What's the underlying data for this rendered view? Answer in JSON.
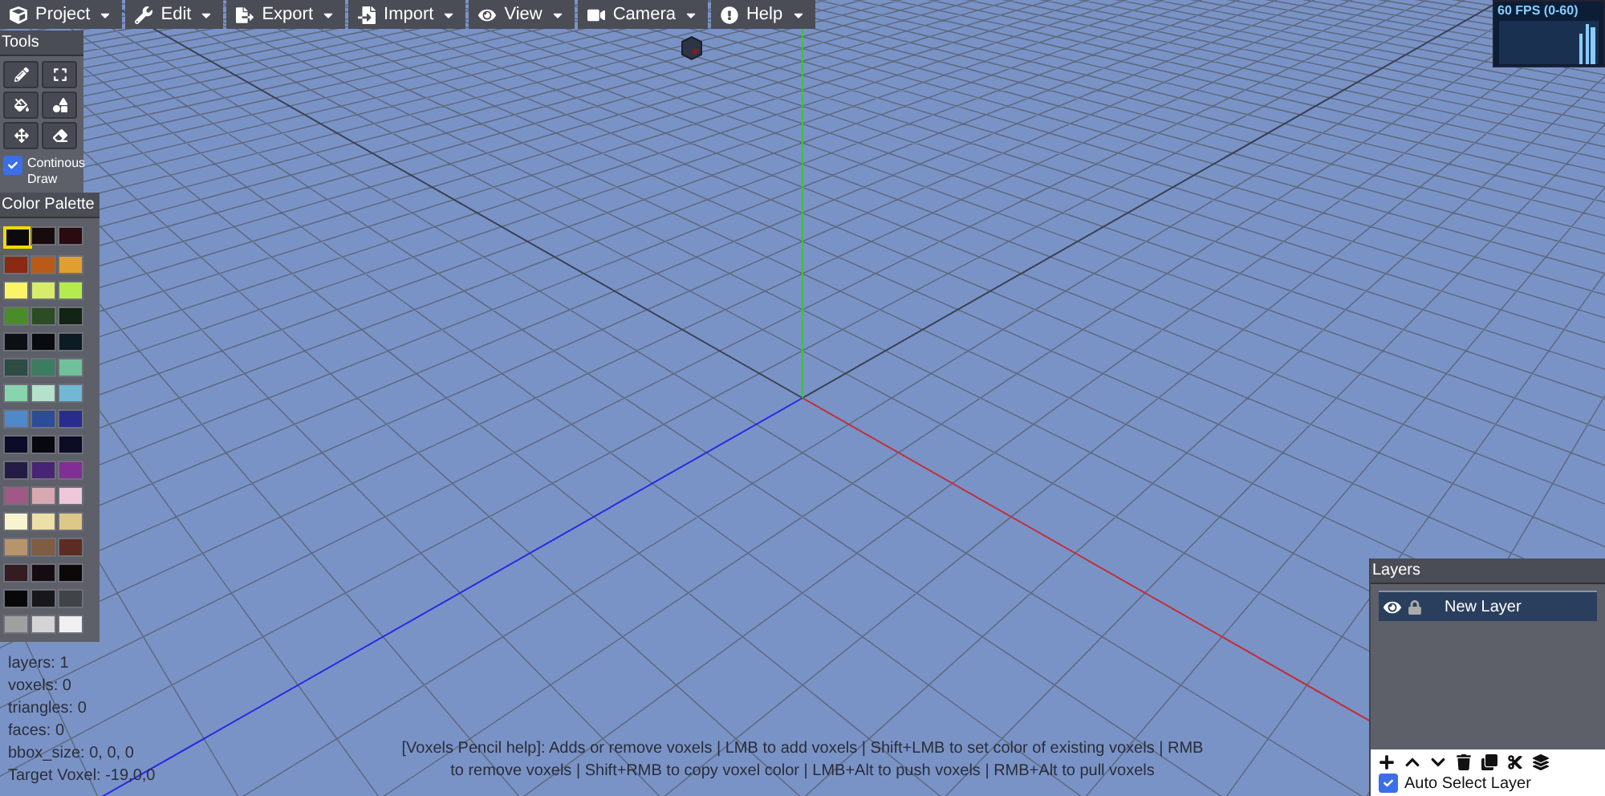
{
  "menu": [
    {
      "label": "Project"
    },
    {
      "label": "Edit"
    },
    {
      "label": "Export"
    },
    {
      "label": "Import"
    },
    {
      "label": "View"
    },
    {
      "label": "Camera"
    },
    {
      "label": "Help"
    }
  ],
  "tools": {
    "title": "Tools",
    "continuous_draw": {
      "label": "Continous Draw",
      "checked": true
    }
  },
  "palette": {
    "title": "Color Palette",
    "colors": [
      {
        "color": "#0b0b0d",
        "selected": true
      },
      {
        "color": "#180b0e",
        "selected": false
      },
      {
        "color": "#2a0b10",
        "selected": false
      },
      {
        "color": "#8a2a12",
        "selected": false
      },
      {
        "color": "#b85a1a",
        "selected": false
      },
      {
        "color": "#e0a030",
        "selected": false
      },
      {
        "color": "#fcf468",
        "selected": false
      },
      {
        "color": "#d8ec6c",
        "selected": false
      },
      {
        "color": "#b4ec50",
        "selected": false
      },
      {
        "color": "#4a8c2a",
        "selected": false
      },
      {
        "color": "#2c4c24",
        "selected": false
      },
      {
        "color": "#142414",
        "selected": false
      },
      {
        "color": "#0c1014",
        "selected": false
      },
      {
        "color": "#080c10",
        "selected": false
      },
      {
        "color": "#0c1c24",
        "selected": false
      },
      {
        "color": "#2c4c44",
        "selected": false
      },
      {
        "color": "#3c7c60",
        "selected": false
      },
      {
        "color": "#70c09c",
        "selected": false
      },
      {
        "color": "#88d4ac",
        "selected": false
      },
      {
        "color": "#b4e0cc",
        "selected": false
      },
      {
        "color": "#70b8d4",
        "selected": false
      },
      {
        "color": "#5088cc",
        "selected": false
      },
      {
        "color": "#2c4c98",
        "selected": false
      },
      {
        "color": "#282c8c",
        "selected": false
      },
      {
        "color": "#0c0c28",
        "selected": false
      },
      {
        "color": "#080810",
        "selected": false
      },
      {
        "color": "#0c0c24",
        "selected": false
      },
      {
        "color": "#241c44",
        "selected": false
      },
      {
        "color": "#482474",
        "selected": false
      },
      {
        "color": "#803094",
        "selected": false
      },
      {
        "color": "#a05884",
        "selected": false
      },
      {
        "color": "#d8a8b0",
        "selected": false
      },
      {
        "color": "#ecc8d8",
        "selected": false
      },
      {
        "color": "#f8f4d0",
        "selected": false
      },
      {
        "color": "#ece0a8",
        "selected": false
      },
      {
        "color": "#dcc888",
        "selected": false
      },
      {
        "color": "#b8946c",
        "selected": false
      },
      {
        "color": "#805c40",
        "selected": false
      },
      {
        "color": "#5c2c24",
        "selected": false
      },
      {
        "color": "#341c20",
        "selected": false
      },
      {
        "color": "#140c10",
        "selected": false
      },
      {
        "color": "#0c0808",
        "selected": false
      },
      {
        "color": "#080808",
        "selected": false
      },
      {
        "color": "#181818",
        "selected": false
      },
      {
        "color": "#404448",
        "selected": false
      },
      {
        "color": "#a0a0a0",
        "selected": false
      },
      {
        "color": "#d4d4d4",
        "selected": false
      },
      {
        "color": "#f0f0f0",
        "selected": false
      }
    ]
  },
  "fps": {
    "label": "60 FPS (0-60)"
  },
  "stats": [
    "layers: 1",
    "voxels: 0",
    "triangles: 0",
    "faces: 0",
    "bbox_size: 0, 0, 0",
    "Target Voxel: -19,0,0"
  ],
  "help_text": "[Voxels Pencil help]: Adds or remove voxels | LMB to add voxels | Shift+LMB to set color of existing voxels | RMB to remove voxels | Shift+RMB to copy voxel color | LMB+Alt to push voxels | RMB+Alt to pull voxels",
  "layers": {
    "title": "Layers",
    "items": [
      {
        "name": "New Layer",
        "visible": true,
        "selected": true
      }
    ],
    "auto_select": {
      "label": "Auto Select Layer",
      "checked": true
    }
  }
}
